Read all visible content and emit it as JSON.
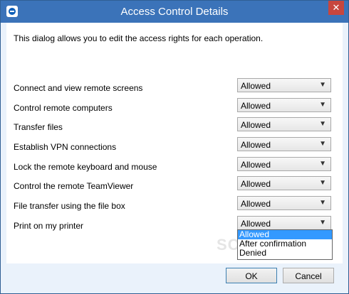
{
  "window": {
    "title": "Access Control Details",
    "close_label": "✕"
  },
  "intro": "This dialog allows you to edit the access rights for each operation.",
  "rows": [
    {
      "label": "Connect and view remote screens",
      "value": "Allowed"
    },
    {
      "label": "Control remote computers",
      "value": "Allowed"
    },
    {
      "label": "Transfer files",
      "value": "Allowed"
    },
    {
      "label": "Establish VPN connections",
      "value": "Allowed"
    },
    {
      "label": "Lock the remote keyboard and mouse",
      "value": "Allowed"
    },
    {
      "label": "Control the remote TeamViewer",
      "value": "Allowed"
    },
    {
      "label": "File transfer using the file box",
      "value": "Allowed"
    },
    {
      "label": "Print on my printer",
      "value": "Allowed"
    }
  ],
  "dropdown": {
    "options": [
      "Allowed",
      "After confirmation",
      "Denied"
    ],
    "selected": "Allowed"
  },
  "watermark": "SOFTPEDIA",
  "buttons": {
    "ok": "OK",
    "cancel": "Cancel"
  },
  "colors": {
    "title_bar": "#3b73b9",
    "selection": "#3399ff",
    "close": "#c7463e"
  }
}
